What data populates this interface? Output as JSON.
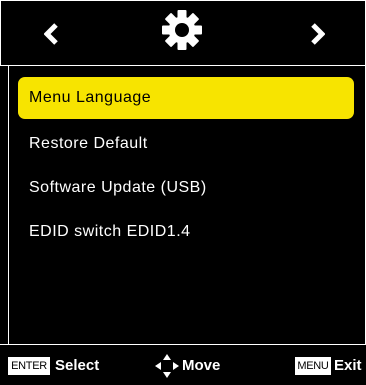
{
  "header": {
    "left_arrow_icon": "chevron-left-icon",
    "right_arrow_icon": "chevron-right-icon",
    "center_icon": "gear-icon"
  },
  "menu": {
    "items": [
      {
        "label": "Menu Language",
        "selected": true
      },
      {
        "label": "Restore Default",
        "selected": false
      },
      {
        "label": "Software Update (USB)",
        "selected": false
      },
      {
        "label": "EDID switch EDID1.4",
        "selected": false
      }
    ]
  },
  "footer": {
    "enter_key": "ENTER",
    "select_label": "Select",
    "move_label": "Move",
    "menu_key": "MENU",
    "exit_label": "Exit"
  },
  "colors": {
    "highlight": "#f7e400",
    "background": "#000000",
    "text": "#ffffff"
  }
}
